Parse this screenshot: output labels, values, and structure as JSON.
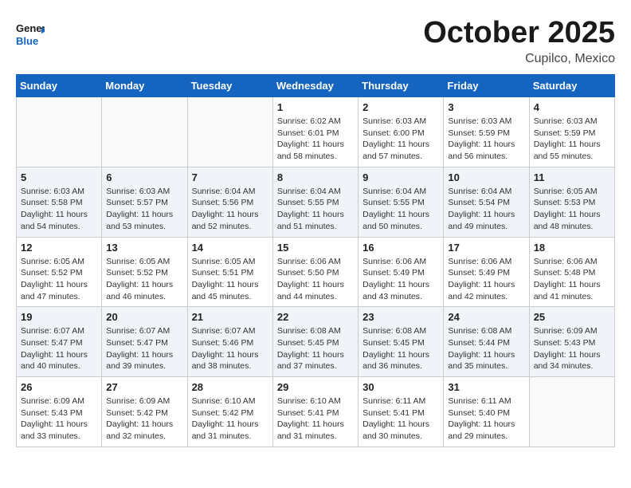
{
  "header": {
    "logo_general": "General",
    "logo_blue": "Blue",
    "month": "October 2025",
    "location": "Cupilco, Mexico"
  },
  "days_of_week": [
    "Sunday",
    "Monday",
    "Tuesday",
    "Wednesday",
    "Thursday",
    "Friday",
    "Saturday"
  ],
  "weeks": [
    [
      {
        "day": "",
        "info": ""
      },
      {
        "day": "",
        "info": ""
      },
      {
        "day": "",
        "info": ""
      },
      {
        "day": "1",
        "info": "Sunrise: 6:02 AM\nSunset: 6:01 PM\nDaylight: 11 hours\nand 58 minutes."
      },
      {
        "day": "2",
        "info": "Sunrise: 6:03 AM\nSunset: 6:00 PM\nDaylight: 11 hours\nand 57 minutes."
      },
      {
        "day": "3",
        "info": "Sunrise: 6:03 AM\nSunset: 5:59 PM\nDaylight: 11 hours\nand 56 minutes."
      },
      {
        "day": "4",
        "info": "Sunrise: 6:03 AM\nSunset: 5:59 PM\nDaylight: 11 hours\nand 55 minutes."
      }
    ],
    [
      {
        "day": "5",
        "info": "Sunrise: 6:03 AM\nSunset: 5:58 PM\nDaylight: 11 hours\nand 54 minutes."
      },
      {
        "day": "6",
        "info": "Sunrise: 6:03 AM\nSunset: 5:57 PM\nDaylight: 11 hours\nand 53 minutes."
      },
      {
        "day": "7",
        "info": "Sunrise: 6:04 AM\nSunset: 5:56 PM\nDaylight: 11 hours\nand 52 minutes."
      },
      {
        "day": "8",
        "info": "Sunrise: 6:04 AM\nSunset: 5:55 PM\nDaylight: 11 hours\nand 51 minutes."
      },
      {
        "day": "9",
        "info": "Sunrise: 6:04 AM\nSunset: 5:55 PM\nDaylight: 11 hours\nand 50 minutes."
      },
      {
        "day": "10",
        "info": "Sunrise: 6:04 AM\nSunset: 5:54 PM\nDaylight: 11 hours\nand 49 minutes."
      },
      {
        "day": "11",
        "info": "Sunrise: 6:05 AM\nSunset: 5:53 PM\nDaylight: 11 hours\nand 48 minutes."
      }
    ],
    [
      {
        "day": "12",
        "info": "Sunrise: 6:05 AM\nSunset: 5:52 PM\nDaylight: 11 hours\nand 47 minutes."
      },
      {
        "day": "13",
        "info": "Sunrise: 6:05 AM\nSunset: 5:52 PM\nDaylight: 11 hours\nand 46 minutes."
      },
      {
        "day": "14",
        "info": "Sunrise: 6:05 AM\nSunset: 5:51 PM\nDaylight: 11 hours\nand 45 minutes."
      },
      {
        "day": "15",
        "info": "Sunrise: 6:06 AM\nSunset: 5:50 PM\nDaylight: 11 hours\nand 44 minutes."
      },
      {
        "day": "16",
        "info": "Sunrise: 6:06 AM\nSunset: 5:49 PM\nDaylight: 11 hours\nand 43 minutes."
      },
      {
        "day": "17",
        "info": "Sunrise: 6:06 AM\nSunset: 5:49 PM\nDaylight: 11 hours\nand 42 minutes."
      },
      {
        "day": "18",
        "info": "Sunrise: 6:06 AM\nSunset: 5:48 PM\nDaylight: 11 hours\nand 41 minutes."
      }
    ],
    [
      {
        "day": "19",
        "info": "Sunrise: 6:07 AM\nSunset: 5:47 PM\nDaylight: 11 hours\nand 40 minutes."
      },
      {
        "day": "20",
        "info": "Sunrise: 6:07 AM\nSunset: 5:47 PM\nDaylight: 11 hours\nand 39 minutes."
      },
      {
        "day": "21",
        "info": "Sunrise: 6:07 AM\nSunset: 5:46 PM\nDaylight: 11 hours\nand 38 minutes."
      },
      {
        "day": "22",
        "info": "Sunrise: 6:08 AM\nSunset: 5:45 PM\nDaylight: 11 hours\nand 37 minutes."
      },
      {
        "day": "23",
        "info": "Sunrise: 6:08 AM\nSunset: 5:45 PM\nDaylight: 11 hours\nand 36 minutes."
      },
      {
        "day": "24",
        "info": "Sunrise: 6:08 AM\nSunset: 5:44 PM\nDaylight: 11 hours\nand 35 minutes."
      },
      {
        "day": "25",
        "info": "Sunrise: 6:09 AM\nSunset: 5:43 PM\nDaylight: 11 hours\nand 34 minutes."
      }
    ],
    [
      {
        "day": "26",
        "info": "Sunrise: 6:09 AM\nSunset: 5:43 PM\nDaylight: 11 hours\nand 33 minutes."
      },
      {
        "day": "27",
        "info": "Sunrise: 6:09 AM\nSunset: 5:42 PM\nDaylight: 11 hours\nand 32 minutes."
      },
      {
        "day": "28",
        "info": "Sunrise: 6:10 AM\nSunset: 5:42 PM\nDaylight: 11 hours\nand 31 minutes."
      },
      {
        "day": "29",
        "info": "Sunrise: 6:10 AM\nSunset: 5:41 PM\nDaylight: 11 hours\nand 31 minutes."
      },
      {
        "day": "30",
        "info": "Sunrise: 6:11 AM\nSunset: 5:41 PM\nDaylight: 11 hours\nand 30 minutes."
      },
      {
        "day": "31",
        "info": "Sunrise: 6:11 AM\nSunset: 5:40 PM\nDaylight: 11 hours\nand 29 minutes."
      },
      {
        "day": "",
        "info": ""
      }
    ]
  ]
}
